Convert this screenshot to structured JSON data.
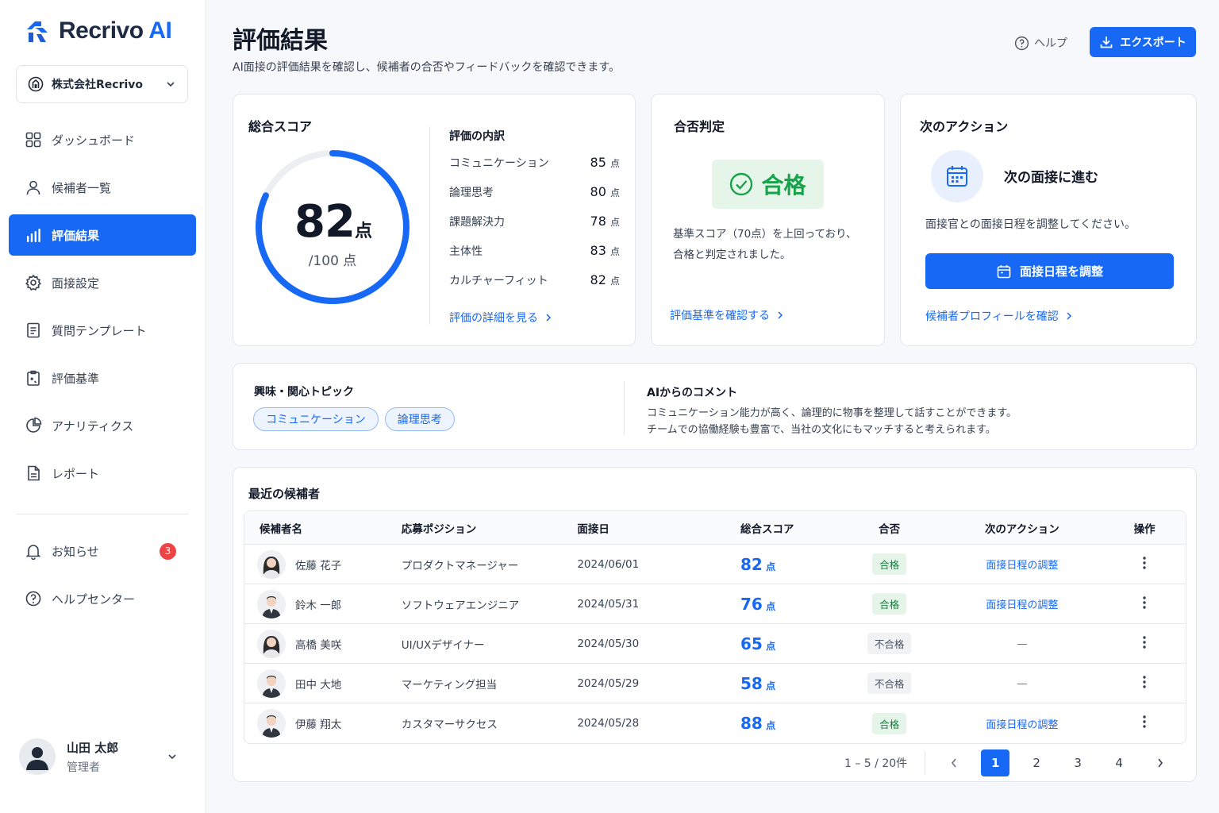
{
  "app": {
    "logo_text": "Recrivo",
    "logo_accent": "AI",
    "accent_color": "#1769f5"
  },
  "company": {
    "name": "株式会社Recrivo"
  },
  "nav": [
    {
      "label": "ダッシュボード",
      "icon": "grid-icon"
    },
    {
      "label": "候補者一覧",
      "icon": "user-icon"
    },
    {
      "label": "評価結果",
      "icon": "bar-chart-icon",
      "active": true
    },
    {
      "label": "面接設定",
      "icon": "gear-icon"
    },
    {
      "label": "質問テンプレート",
      "icon": "document-icon"
    },
    {
      "label": "評価基準",
      "icon": "clipboard-icon"
    },
    {
      "label": "アナリティクス",
      "icon": "pie-chart-icon"
    },
    {
      "label": "レポート",
      "icon": "report-icon"
    }
  ],
  "nav_secondary": [
    {
      "label": "お知らせ",
      "icon": "bell-icon",
      "badge": "3"
    },
    {
      "label": "ヘルプセンター",
      "icon": "help-icon"
    }
  ],
  "user": {
    "name": "山田 太郎",
    "role": "管理者"
  },
  "header": {
    "title": "評価結果",
    "subtitle": "AI面接の評価結果を確認し、候補者の合否やフィードバックを確認できます。",
    "help_label": "ヘルプ",
    "export_label": "エクスポート"
  },
  "score": {
    "title": "総合スコア",
    "value": "82",
    "unit": "点",
    "max_label": "/100 点",
    "progress": 0.82,
    "breakdown_title": "評価の内訳",
    "breakdown": [
      {
        "label": "コミュニケーション",
        "value": "85",
        "unit": "点"
      },
      {
        "label": "論理思考",
        "value": "80",
        "unit": "点"
      },
      {
        "label": "課題解決力",
        "value": "78",
        "unit": "点"
      },
      {
        "label": "主体性",
        "value": "83",
        "unit": "点"
      },
      {
        "label": "カルチャーフィット",
        "value": "82",
        "unit": "点"
      }
    ],
    "detail_link": "評価の詳細を見る"
  },
  "decision": {
    "title": "合否判定",
    "result": "合格",
    "line1": "基準スコア（70点）を上回っており、",
    "line2": "合格と判定されました。",
    "link": "評価基準を確認する"
  },
  "next_action": {
    "title": "次のアクション",
    "heading": "次の面接に進む",
    "description": "面接官との面接日程を調整してください。",
    "button": "面接日程を調整",
    "link": "候補者プロフィールを確認"
  },
  "topics": {
    "title": "興味・関心トピック",
    "chips": [
      "コミュニケーション",
      "論理思考"
    ]
  },
  "ai_comment": {
    "title": "AIからのコメント",
    "line1": "コミュニケーション能力が高く、論理的に物事を整理して話すことができます。",
    "line2": "チームでの協働経験も豊富で、当社の文化にもマッチすると考えられます。"
  },
  "recent": {
    "title": "最近の候補者",
    "columns": [
      "候補者名",
      "応募ポジション",
      "面接日",
      "総合スコア",
      "合否",
      "次のアクション",
      "操作"
    ],
    "rows": [
      {
        "name": "佐藤 花子",
        "position": "プロダクトマネージャー",
        "date": "2024/06/01",
        "score": "82",
        "unit": "点",
        "result": "合格",
        "pass": true,
        "action": "面接日程の調整",
        "gender": "f"
      },
      {
        "name": "鈴木 一郎",
        "position": "ソフトウェアエンジニア",
        "date": "2024/05/31",
        "score": "76",
        "unit": "点",
        "result": "合格",
        "pass": true,
        "action": "面接日程の調整",
        "gender": "m"
      },
      {
        "name": "高橋 美咲",
        "position": "UI/UXデザイナー",
        "date": "2024/05/30",
        "score": "65",
        "unit": "点",
        "result": "不合格",
        "pass": false,
        "action": "—",
        "gender": "f"
      },
      {
        "name": "田中 大地",
        "position": "マーケティング担当",
        "date": "2024/05/29",
        "score": "58",
        "unit": "点",
        "result": "不合格",
        "pass": false,
        "action": "—",
        "gender": "m"
      },
      {
        "name": "伊藤 翔太",
        "position": "カスタマーサクセス",
        "date": "2024/05/28",
        "score": "88",
        "unit": "点",
        "result": "合格",
        "pass": true,
        "action": "面接日程の調整",
        "gender": "m"
      }
    ],
    "pagination": {
      "info": "1 – 5 / 20件",
      "pages": [
        "1",
        "2",
        "3",
        "4"
      ],
      "current": "1"
    }
  }
}
